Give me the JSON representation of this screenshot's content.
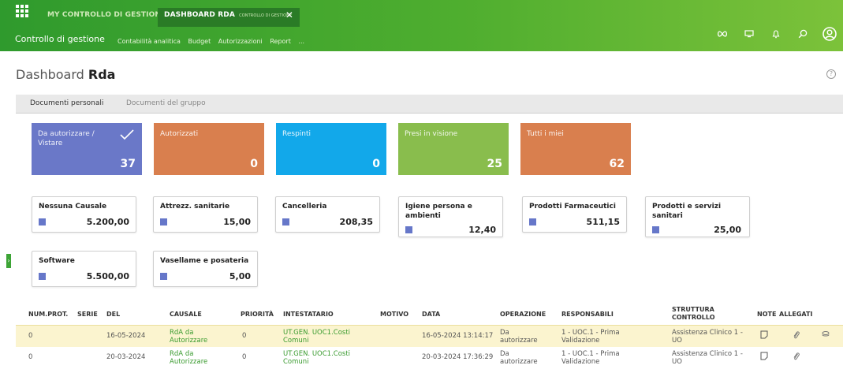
{
  "header": {
    "apps": [
      "MY CONTROLLO DI GESTIONE",
      "DASHBOARD RDA"
    ],
    "active_sub": "CONTROLLO DI GESTIONE",
    "close": "✕",
    "brand": "Controllo di gestione",
    "menu": [
      "Contabilità analitica",
      "Budget",
      "Autorizzazioni",
      "Report",
      "..."
    ]
  },
  "page": {
    "title_prefix": "Dashboard",
    "title_bold": "Rda",
    "help": "?"
  },
  "tabs": [
    "Documenti personali",
    "Documenti del gruppo"
  ],
  "tiles": [
    {
      "label": "Da autorizzare / Vistare",
      "value": "37",
      "color": "#6a78c8"
    },
    {
      "label": "Autorizzati",
      "value": "0",
      "color": "#d97f4e"
    },
    {
      "label": "Respinti",
      "value": "0",
      "color": "#12a8ea"
    },
    {
      "label": "Presi in visione",
      "value": "25",
      "color": "#89bd4d"
    },
    {
      "label": "Tutti i miei",
      "value": "62",
      "color": "#d97f4e"
    }
  ],
  "cards": [
    {
      "label": "Nessuna Causale",
      "value": "5.200,00"
    },
    {
      "label": "Attrezz. sanitarie",
      "value": "15,00"
    },
    {
      "label": "Cancelleria",
      "value": "208,35"
    },
    {
      "label": "Igiene persona e ambienti",
      "value": "12,40"
    },
    {
      "label": "Prodotti Farmaceutici",
      "value": "511,15"
    },
    {
      "label": "Prodotti e servizi sanitari",
      "value": "25,00"
    },
    {
      "label": "Software",
      "value": "5.500,00"
    },
    {
      "label": "Vasellame e posateria",
      "value": "5,00"
    }
  ],
  "table": {
    "headers": [
      "NUM.PROT.",
      "SERIE",
      "DEL",
      "CAUSALE",
      "PRIORITÀ",
      "INTESTATARIO",
      "MOTIVO",
      "DATA",
      "OPERAZIONE",
      "RESPONSABILI",
      "STRUTTURA CONTROLLO",
      "NOTE",
      "ALLEGATI"
    ],
    "rows": [
      {
        "num": "0",
        "serie": "",
        "del": "16-05-2024",
        "causale": "RdA da Autorizzare",
        "priorita": "0",
        "intestatario": "UT.GEN. UOC1.Costi Comuni",
        "motivo": "",
        "data": "16-05-2024 13:14:17",
        "operazione": "Da autorizzare",
        "responsabili": "1 - UOC.1 - Prima Validazione",
        "struttura": "Assistenza Clinico 1 - UO"
      },
      {
        "num": "0",
        "serie": "",
        "del": "20-03-2024",
        "causale": "RdA da Autorizzare",
        "priorita": "0",
        "intestatario": "UT.GEN. UOC1.Costi Comuni",
        "motivo": "",
        "data": "20-03-2024 17:36:29",
        "operazione": "Da autorizzare",
        "responsabili": "1 - UOC.1 - Prima Validazione",
        "struttura": "Assistenza Clinico 1 - UO"
      }
    ]
  }
}
